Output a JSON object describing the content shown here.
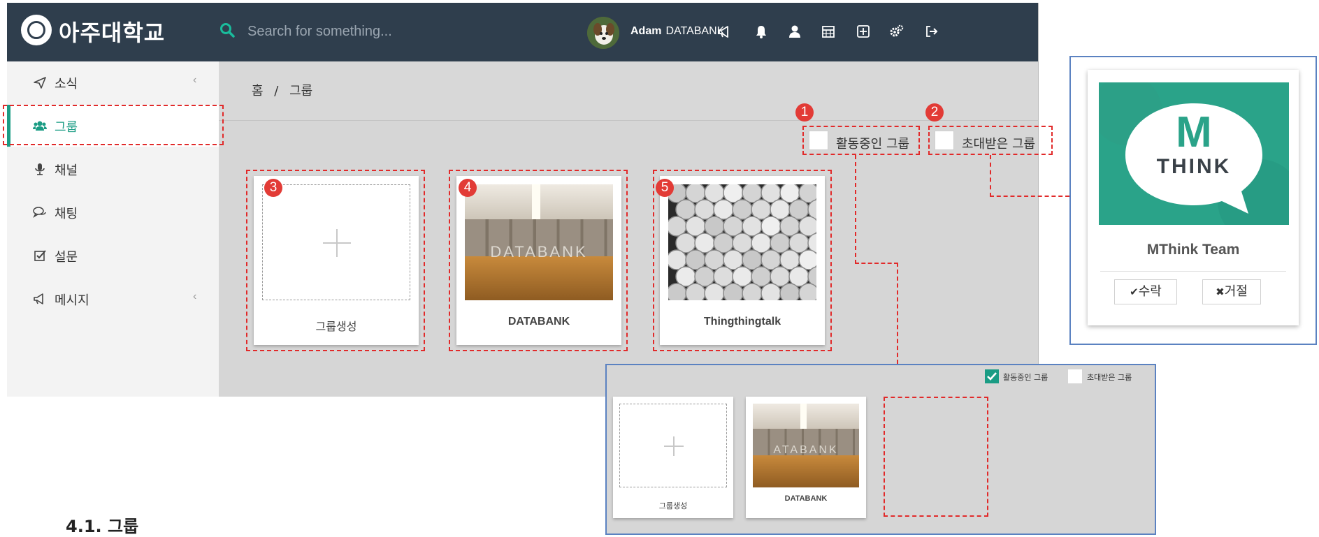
{
  "app": {
    "logo_text": "아주대학교",
    "search_placeholder": "Search for something...",
    "user_first": "Adam",
    "user_last": "DATABANK",
    "top_icons": [
      "megaphone-icon",
      "bell-icon",
      "user-icon",
      "calendar-icon",
      "plus-square-icon",
      "cogs-icon",
      "sign-out-icon"
    ]
  },
  "sidebar": {
    "items": [
      {
        "label": "소식",
        "icon": "paper-plane-icon",
        "has_submenu": true
      },
      {
        "label": "그룹",
        "icon": "users-icon",
        "active": true
      },
      {
        "label": "채널",
        "icon": "microphone-icon"
      },
      {
        "label": "채팅",
        "icon": "comments-icon"
      },
      {
        "label": "설문",
        "icon": "check-square-icon"
      },
      {
        "label": "메시지",
        "icon": "megaphone-icon",
        "has_submenu": true
      }
    ],
    "chevron": "‹"
  },
  "breadcrumb": {
    "home": "홈",
    "separator": "/",
    "current": "그룹"
  },
  "filters": {
    "active_groups": "활동중인 그룹",
    "invited_groups": "초대받은 그룹"
  },
  "cards": {
    "create": "그룹생성",
    "group1": "DATABANK",
    "group2": "Thingthingtalk",
    "photo_sign": "DATABANK"
  },
  "markers": [
    "1",
    "2",
    "3",
    "4",
    "5"
  ],
  "popup": {
    "logo_letter": "M",
    "logo_word": "THINK",
    "title": "MThink Team",
    "accept": "수락",
    "reject": "거절",
    "accept_icon": "✔",
    "reject_icon": "✖"
  },
  "inset": {
    "active_groups": "활동중인 그룹",
    "invited_groups": "초대받은 그룹",
    "create": "그룹생성",
    "group1": "DATABANK",
    "photo_sign": "ATABANK",
    "active_checked": true
  },
  "section_heading": "4.1. 그룹",
  "colors": {
    "topbar": "#2f3e4d",
    "accent_green": "#1a9c84",
    "annotation_red": "#e12a2a",
    "frame_blue": "#5b82c1",
    "mthink_teal": "#2aa389"
  }
}
